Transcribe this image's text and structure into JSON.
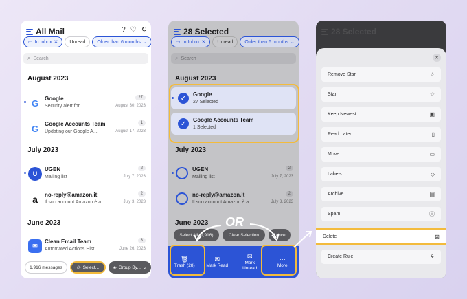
{
  "panel1": {
    "title": "All Mail",
    "chips": [
      "In Inbox",
      "Unread",
      "Older than 6 months"
    ],
    "search_placeholder": "Search",
    "sections": [
      "August 2023",
      "July 2023",
      "June 2023"
    ],
    "items": [
      {
        "sender": "Google",
        "subject": "Security alert for ...",
        "count": "27",
        "date": "August 30, 2023"
      },
      {
        "sender": "Google Accounts Team",
        "subject": "Updating our Google A...",
        "count": "1",
        "date": "August 17, 2023"
      },
      {
        "sender": "UGEN",
        "subject": "Mailing list",
        "count": "2",
        "date": "July 7, 2023"
      },
      {
        "sender": "no-reply@amazon.it",
        "subject": "Il suo account Amazon è a...",
        "count": "2",
        "date": "July 3, 2023"
      },
      {
        "sender": "Clean Email Team",
        "subject": "Automated Actions Hist...",
        "count": "3",
        "date": "June 26, 2023"
      }
    ],
    "bottom": {
      "messages": "1,916 messages",
      "select": "Select...",
      "group": "Group By..."
    }
  },
  "panel2": {
    "title": "28 Selected",
    "chips": [
      "In Inbox",
      "Unread",
      "Older than 6 months"
    ],
    "search_placeholder": "Search",
    "sections": [
      "August 2023",
      "July 2023",
      "June 2023"
    ],
    "items": [
      {
        "sender": "Google",
        "subject": "27 Selected"
      },
      {
        "sender": "Google Accounts Team",
        "subject": "1 Selected"
      },
      {
        "sender": "UGEN",
        "subject": "Mailing list",
        "count": "2",
        "date": "July 7, 2023"
      },
      {
        "sender": "no-reply@amazon.it",
        "subject": "Il suo account Amazon è a...",
        "count": "2",
        "date": "July 3, 2023"
      }
    ],
    "floating": {
      "select_all": "Select All (1,916)",
      "clear": "Clear Selection",
      "cancel": "Cancel"
    },
    "actions": [
      "Trash (28)",
      "Mark Read",
      "Mark Unread",
      "More"
    ]
  },
  "panel3": {
    "title": "28 Selected",
    "menu": [
      "Remove Star",
      "Star",
      "Keep Newest",
      "Read Later",
      "Move...",
      "Labels...",
      "Archive",
      "Spam",
      "Delete",
      "Create Rule"
    ]
  },
  "or_label": "OR",
  "colors": {
    "accent": "#2c54d6",
    "highlight": "#f3bb3c"
  }
}
